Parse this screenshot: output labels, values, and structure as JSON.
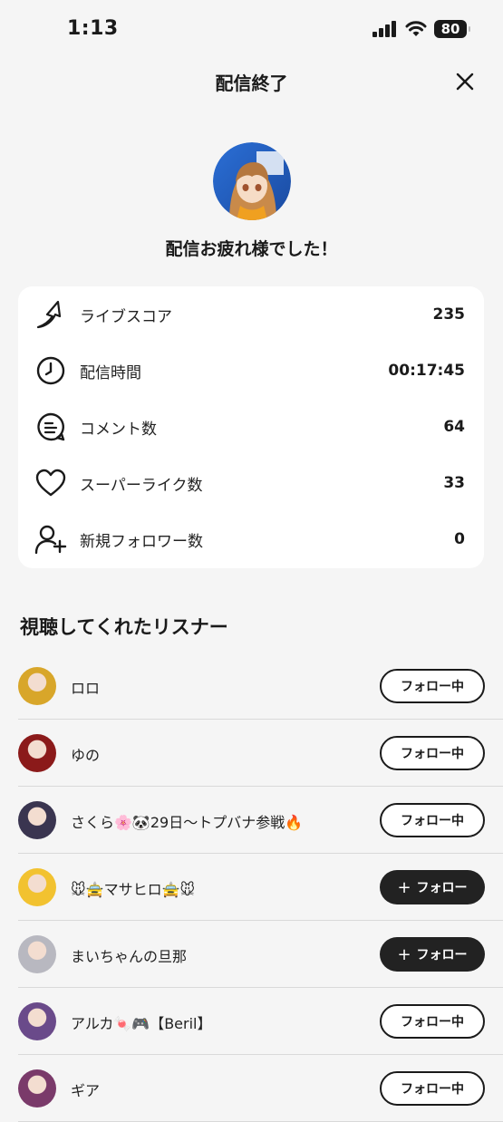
{
  "status_bar": {
    "time": "1:13",
    "battery": "80"
  },
  "header": {
    "title": "配信終了"
  },
  "done_message": "配信お疲れ様でした！",
  "stats": [
    {
      "icon": "arrow-up-icon",
      "label": "ライブスコア",
      "value": "235"
    },
    {
      "icon": "clock-icon",
      "label": "配信時間",
      "value": "00:17:45"
    },
    {
      "icon": "comment-icon",
      "label": "コメント数",
      "value": "64"
    },
    {
      "icon": "heart-icon",
      "label": "スーパーライク数",
      "value": "33"
    },
    {
      "icon": "add-user-icon",
      "label": "新規フォロワー数",
      "value": "0"
    }
  ],
  "listeners_section": {
    "title": "視聴してくれたリスナー"
  },
  "listeners": [
    {
      "name": "ロロ",
      "button": "フォロー中",
      "following": true,
      "avatar_color": "#d8a62a"
    },
    {
      "name": "ゆの",
      "button": "フォロー中",
      "following": true,
      "avatar_color": "#8b1a1a"
    },
    {
      "name": "さくら🌸🐼29日〜トプバナ参戦🔥",
      "button": "フォロー中",
      "following": true,
      "avatar_color": "#3a3550"
    },
    {
      "name": "🐭🚖マサヒロ🚖🐭",
      "button": "フォロー",
      "following": false,
      "avatar_color": "#f2c230"
    },
    {
      "name": "まいちゃんの旦那",
      "button": "フォロー",
      "following": false,
      "avatar_color": "#b8b8c0"
    },
    {
      "name": "アルカ🍬🎮【Beril】",
      "button": "フォロー中",
      "following": true,
      "avatar_color": "#6a4a8a"
    },
    {
      "name": "ギア",
      "button": "フォロー中",
      "following": true,
      "avatar_color": "#7a3a6a"
    }
  ]
}
